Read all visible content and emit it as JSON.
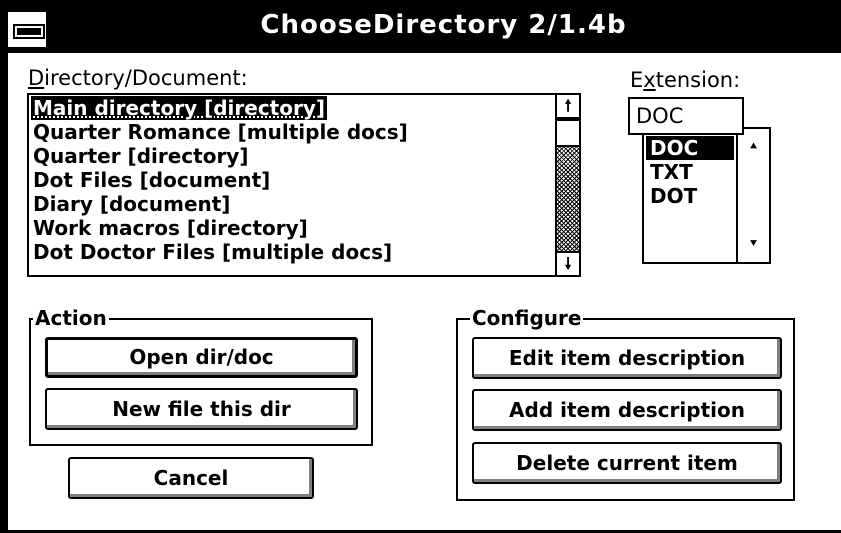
{
  "window": {
    "title": "ChooseDirectory 2/1.4b"
  },
  "directory": {
    "label": "Directory/Document:",
    "items": [
      "Main directory [directory]",
      "Quarter Romance [multiple docs]",
      "Quarter [directory]",
      "Dot Files   [document]",
      "Diary  [document]",
      "Work macros [directory]",
      "Dot Doctor Files [multiple docs]"
    ],
    "selected_index": 0
  },
  "extension": {
    "label": "Extension:",
    "value": "DOC",
    "options": [
      "DOC",
      "TXT",
      "DOT"
    ],
    "selected_index": 0
  },
  "action": {
    "title": "Action",
    "open_label": "Open dir/doc",
    "new_label": "New file this dir",
    "cancel_label": "Cancel"
  },
  "configure": {
    "title": "Configure",
    "edit_label": "Edit item description",
    "add_label": "Add item description",
    "delete_label": "Delete current item"
  },
  "icons": {
    "scroll_up": "arrow-up-icon",
    "scroll_down": "arrow-down-icon",
    "system_menu": "system-menu-icon"
  }
}
